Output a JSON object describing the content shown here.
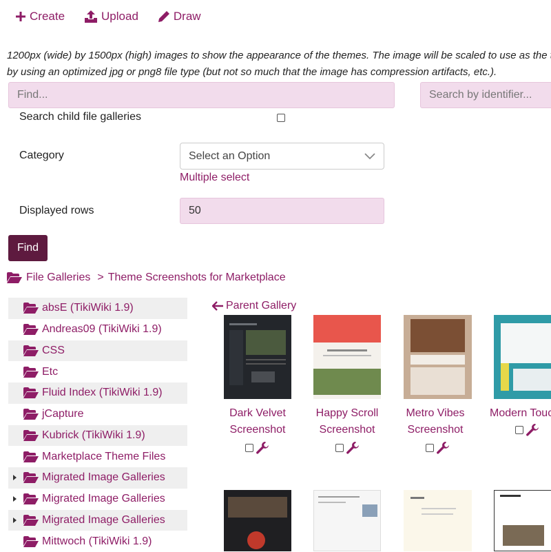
{
  "toolbar": {
    "create_label": "Create",
    "upload_label": "Upload",
    "draw_label": "Draw"
  },
  "description": {
    "line1": "1200px (wide) by 1500px (high) images to show the appearance of the themes. The image will be scaled to use as the th",
    "line2": "by using an optimized jpg or png8 file type (but not so much that the image has compression artifacts, etc.)."
  },
  "search": {
    "find_placeholder": "Find...",
    "identifier_placeholder": "Search by identifier..."
  },
  "filters": {
    "child_galleries_label": "Search child file galleries",
    "category_label": "Category",
    "category_value": "Select an Option",
    "multiple_select_label": "Multiple select",
    "rows_label": "Displayed rows",
    "rows_value": "50",
    "find_button": "Find"
  },
  "breadcrumb": {
    "root": "File Galleries",
    "separator": ">",
    "current": "Theme Screenshots for Marketplace"
  },
  "tree": {
    "items": [
      {
        "label": "absE (TikiWiki 1.9)",
        "expandable": false
      },
      {
        "label": "Andreas09 (TikiWiki 1.9)",
        "expandable": false
      },
      {
        "label": "CSS",
        "expandable": false
      },
      {
        "label": "Etc",
        "expandable": false
      },
      {
        "label": "Fluid Index (TikiWiki 1.9)",
        "expandable": false
      },
      {
        "label": "jCapture",
        "expandable": false
      },
      {
        "label": "Kubrick (TikiWiki 1.9)",
        "expandable": false
      },
      {
        "label": "Marketplace Theme Files",
        "expandable": false
      },
      {
        "label": "Migrated Image Galleries",
        "expandable": true
      },
      {
        "label": "Migrated Image Galleries",
        "expandable": true
      },
      {
        "label": "Migrated Image Galleries",
        "expandable": true
      },
      {
        "label": "Mittwoch (TikiWiki 1.9)",
        "expandable": false
      }
    ]
  },
  "gallery": {
    "parent_label": "Parent Gallery",
    "files": [
      {
        "line1": "Dark Velvet",
        "line2": "Screenshot"
      },
      {
        "line1": "Happy Scroll",
        "line2": "Screenshot"
      },
      {
        "line1": "Metro Vibes",
        "line2": "Screenshot"
      },
      {
        "line1": "Modern Touc",
        "line2": ""
      }
    ]
  },
  "colors": {
    "accent": "#8e1d66",
    "button_bg": "#5e1a3f",
    "input_bg": "#f2dcec"
  }
}
